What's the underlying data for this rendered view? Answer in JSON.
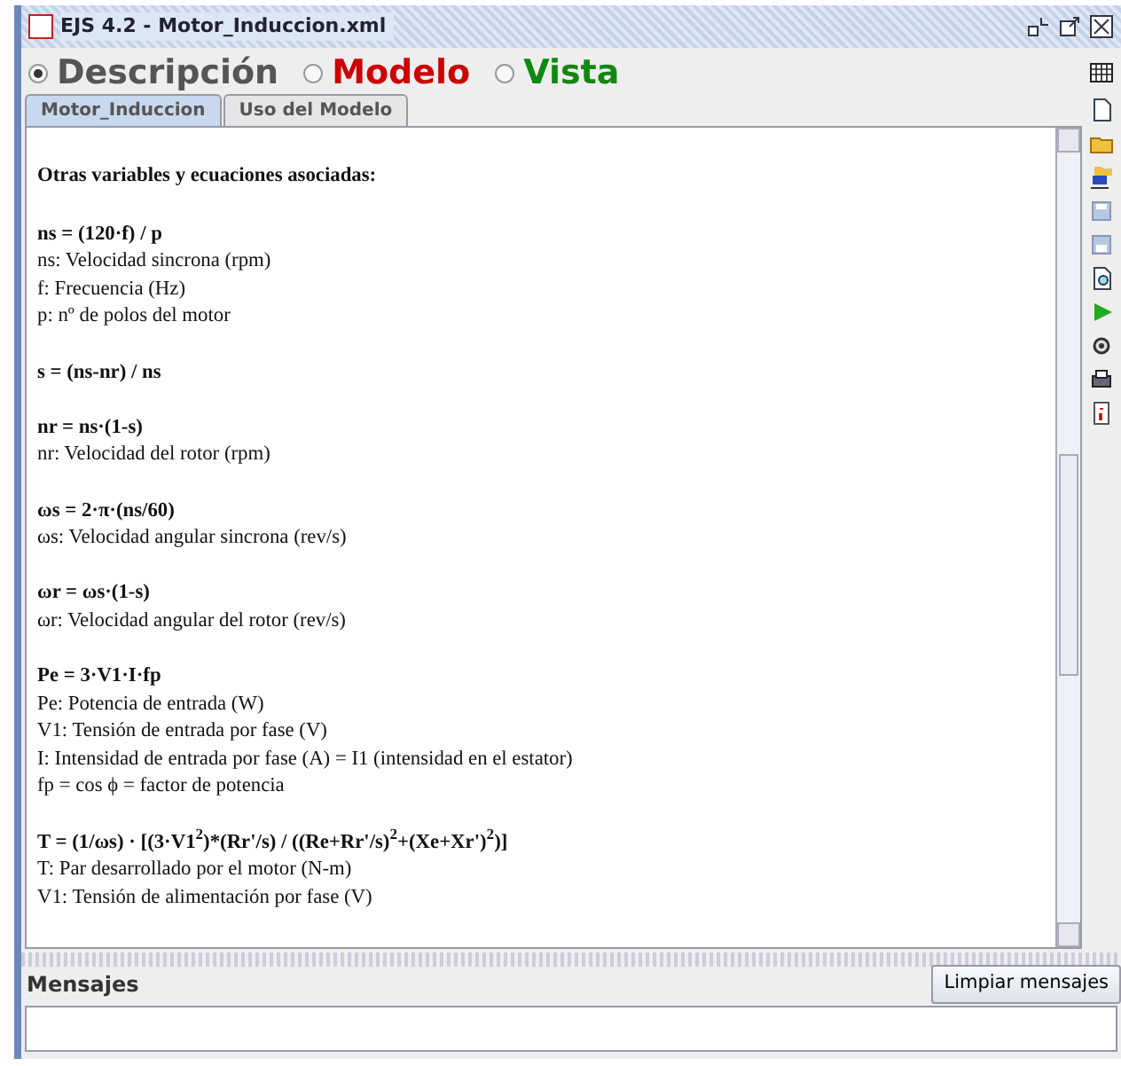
{
  "window": {
    "title": "EJS 4.2 - Motor_Induccion.xml"
  },
  "modes": [
    {
      "label": "Descripción",
      "selected": true,
      "color": "#555555"
    },
    {
      "label": "Modelo",
      "selected": false,
      "color": "#cc0000"
    },
    {
      "label": "Vista",
      "selected": false,
      "color": "#118811"
    }
  ],
  "tabs": [
    {
      "label": "Motor_Induccion",
      "selected": true
    },
    {
      "label": "Uso del Modelo",
      "selected": false
    }
  ],
  "document": {
    "blocks": [
      [
        {
          "text": "Otras variables y ecuaciones asociadas:",
          "bold": true
        }
      ],
      [
        {
          "text": "ns = (120·f) / p",
          "bold": true
        },
        {
          "text": "ns: Velocidad sincrona (rpm)",
          "bold": false
        },
        {
          "text": "f: Frecuencia (Hz)",
          "bold": false
        },
        {
          "text": "p: nº de polos del motor",
          "bold": false
        }
      ],
      [
        {
          "text": "s = (ns-nr) / ns",
          "bold": true
        }
      ],
      [
        {
          "text": "nr = ns·(1-s)",
          "bold": true
        },
        {
          "text": "nr: Velocidad del rotor (rpm)",
          "bold": false
        }
      ],
      [
        {
          "text": "ωs = 2·π·(ns/60)",
          "bold": true
        },
        {
          "text": "ωs: Velocidad angular sincrona (rev/s)",
          "bold": false
        }
      ],
      [
        {
          "text": "ωr = ωs·(1-s)",
          "bold": true
        },
        {
          "text": "ωr: Velocidad angular del rotor (rev/s)",
          "bold": false
        }
      ],
      [
        {
          "text": "Pe = 3·V1·I·fp",
          "bold": true
        },
        {
          "text": "Pe: Potencia de entrada (W)",
          "bold": false
        },
        {
          "text": "V1: Tensión de entrada por fase (V)",
          "bold": false
        },
        {
          "text": "I: Intensidad de entrada por fase (A) = I1 (intensidad en el estator)",
          "bold": false
        },
        {
          "text": "fp = cos ϕ = factor de potencia",
          "bold": false
        }
      ],
      [
        {
          "text": "T = (1/ωs) · [(3·V1$^{2}$)*(Rr'/s) / ((Re+Rr'/s)$^{2}$+(Xe+Xr')$^{2}$)]",
          "bold": true
        },
        {
          "text": "T: Par desarrollado por el motor (N-m)",
          "bold": false
        },
        {
          "text": "V1: Tensión de alimentación por fase (V)",
          "bold": false
        }
      ]
    ]
  },
  "messages": {
    "title": "Mensajes",
    "button": "Limpiar mensajes"
  }
}
